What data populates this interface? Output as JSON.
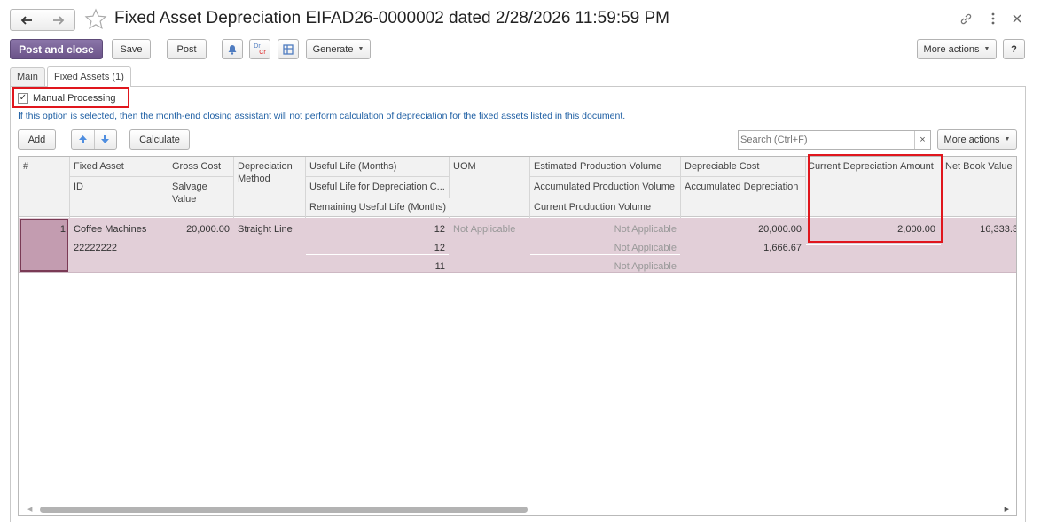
{
  "window": {
    "title": "Fixed Asset Depreciation EIFAD26-0000002 dated 2/28/2026 11:59:59 PM"
  },
  "toolbar": {
    "post_and_close": "Post and close",
    "save": "Save",
    "post": "Post",
    "dr_label": "Dr",
    "cr_label": "Cr",
    "generate": "Generate",
    "more_actions": "More actions",
    "help": "?"
  },
  "tabs": [
    {
      "label": "Main",
      "active": false
    },
    {
      "label": "Fixed Assets (1)",
      "active": true
    }
  ],
  "form": {
    "manual_processing_label": "Manual Processing",
    "manual_processing_checked": true,
    "info_text": "If this option is selected, then the month-end closing assistant will not perform calculation of depreciation for the fixed assets listed in this document."
  },
  "grid_toolbar": {
    "add": "Add",
    "calculate": "Calculate",
    "search_placeholder": "Search (Ctrl+F)",
    "clear": "×",
    "more_actions": "More actions"
  },
  "grid": {
    "headers": {
      "row_number": "#",
      "fixed_asset": "Fixed Asset",
      "id": "ID",
      "gross_cost": "Gross Cost",
      "salvage_value": "Salvage Value",
      "depreciation_method": "Depreciation Method",
      "useful_life": "Useful Life (Months)",
      "useful_life_depr": "Useful Life for Depreciation C...",
      "remaining_life": "Remaining Useful Life (Months)",
      "uom": "UOM",
      "est_production": "Estimated Production Volume",
      "acc_production": "Accumulated Production Volume",
      "cur_production": "Current Production Volume",
      "depreciable_cost": "Depreciable Cost",
      "acc_depreciation": "Accumulated Depreciation",
      "current_depreciation": "Current Depreciation Amount",
      "net_book_value": "Net Book Value"
    },
    "rows": [
      {
        "row_number": "1",
        "fixed_asset": "Coffee Machines",
        "id": "22222222",
        "gross_cost": "20,000.00",
        "depreciation_method": "Straight Line",
        "useful_life": "12",
        "useful_life_depr": "12",
        "remaining_life": "11",
        "uom": "Not Applicable",
        "est_production": "Not Applicable",
        "acc_production": "Not Applicable",
        "cur_production": "Not Applicable",
        "depreciable_cost": "20,000.00",
        "acc_depreciation": "1,666.67",
        "current_depreciation": "2,000.00",
        "net_book_value": "16,333.3"
      }
    ]
  },
  "colors": {
    "accent": "#6b5389",
    "row_highlight": "#e2cfd8",
    "row_selected_cell": "#c39cb0",
    "annotation_red": "#e0161d",
    "info_text": "#1d5ea3"
  }
}
